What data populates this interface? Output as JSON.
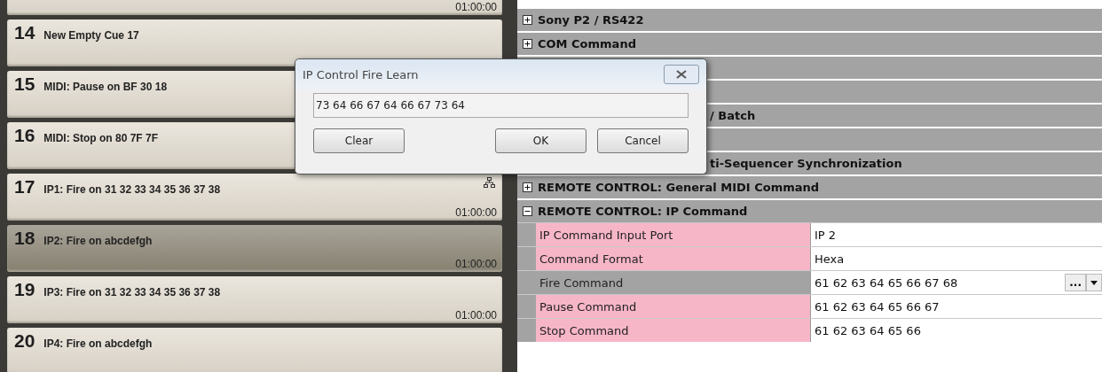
{
  "cues": [
    {
      "time": "01:00:00",
      "selected": false,
      "network": false,
      "kind": "partial"
    },
    {
      "number": "14",
      "title": "New Empty Cue 17",
      "selected": false,
      "network": false,
      "kind": "full"
    },
    {
      "number": "15",
      "title": "MIDI: Pause on BF 30 18",
      "selected": false,
      "network": false,
      "kind": "full"
    },
    {
      "number": "16",
      "title": "MIDI: Stop on 80 7F 7F",
      "selected": false,
      "network": false,
      "kind": "full"
    },
    {
      "number": "17",
      "title": "IP1: Fire on 31 32 33 34 35 36 37 38",
      "time": "01:00:00",
      "selected": false,
      "network": true,
      "kind": "full"
    },
    {
      "number": "18",
      "title": "IP2: Fire on abcdefgh",
      "time": "01:00:00",
      "selected": true,
      "network": false,
      "kind": "full"
    },
    {
      "number": "19",
      "title": "IP3: Fire on 31 32 33 34 35 36 37 38",
      "time": "01:00:00",
      "selected": false,
      "network": false,
      "kind": "full"
    },
    {
      "number": "20",
      "title": "IP4: Fire on abcdefgh",
      "selected": false,
      "network": false,
      "kind": "full"
    }
  ],
  "sections": [
    {
      "label": "Sony P2 / RS422",
      "expanded": false,
      "kind": "open"
    },
    {
      "label": "COM Command",
      "expanded": false,
      "kind": "open"
    },
    {
      "kind": "covered"
    },
    {
      "kind": "covered"
    },
    {
      "label": "/ Batch",
      "kind": "covered"
    },
    {
      "kind": "covered"
    },
    {
      "label": "ti-Sequencer Synchronization",
      "kind": "covered"
    },
    {
      "label": "REMOTE CONTROL: General MIDI Command",
      "expanded": false,
      "kind": "open"
    },
    {
      "label": "REMOTE CONTROL: IP Command",
      "expanded": true,
      "kind": "open",
      "properties": [
        {
          "name": "IP Command Input Port",
          "value": "IP 2",
          "selected": false
        },
        {
          "name": "Command Format",
          "value": "Hexa",
          "selected": false
        },
        {
          "name": "Fire Command",
          "value": "61 62 63 64 65 66 67 68",
          "selected": true,
          "ellipsis": "..."
        },
        {
          "name": "Pause Command",
          "value": "61 62 63 64 65 66 67",
          "selected": false
        },
        {
          "name": "Stop Command",
          "value": "61 62 63 64 65 66",
          "selected": false
        }
      ]
    }
  ],
  "dialog": {
    "title": "IP Control Fire Learn",
    "value": "73 64 66 67 64 66 67 73 64",
    "buttons": [
      "Clear",
      "OK",
      "Cancel"
    ]
  }
}
